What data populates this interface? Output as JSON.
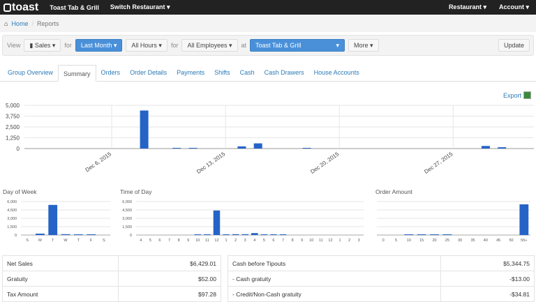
{
  "topbar": {
    "logo": "toast",
    "restaurant": "Toast Tab & Grill",
    "switch": "Switch Restaurant ▾",
    "menu_restaurant": "Restaurant ▾",
    "menu_account": "Account ▾"
  },
  "breadcrumb": {
    "home": "Home",
    "sep": "/",
    "current": "Reports"
  },
  "filters": {
    "view_label": "View",
    "view": "Sales ▾",
    "for1": "for",
    "period": "Last Month ▾",
    "hours": "All Hours ▾",
    "for2": "for",
    "employees": "All Employees ▾",
    "at": "at",
    "location": "Toast Tab & Grill",
    "location_caret": "▾",
    "more": "More ▾",
    "update": "Update"
  },
  "tabs": [
    "Group Overview",
    "Summary",
    "Orders",
    "Order Details",
    "Payments",
    "Shifts",
    "Cash",
    "Cash Drawers",
    "House Accounts"
  ],
  "active_tab": "Summary",
  "export": "Export",
  "colors": {
    "bar": "#2563c7",
    "accent": "#4a90d9",
    "link": "#2a7ab8"
  },
  "chart_data": [
    {
      "type": "bar",
      "title": "",
      "x_ticks": [
        "Dec 6, 2015",
        "Dec 13, 2015",
        "Dec 20, 2015",
        "Dec 27, 2015"
      ],
      "y_ticks": [
        "5,000",
        "3,750",
        "2,500",
        "1,250",
        "0"
      ],
      "ylim": [
        0,
        5000
      ],
      "grid": true,
      "x": [
        "Dec 8",
        "Dec 10",
        "Dec 11",
        "Dec 14",
        "Dec 15",
        "Dec 18",
        "Dec 29",
        "Dec 30"
      ],
      "day": [
        8,
        10,
        11,
        14,
        15,
        18,
        29,
        30
      ],
      "values": [
        4400,
        60,
        20,
        250,
        600,
        50,
        300,
        150
      ]
    },
    {
      "type": "bar",
      "title": "Day of Week",
      "categories": [
        "S",
        "M",
        "T",
        "W",
        "T",
        "F",
        "S"
      ],
      "values": [
        0,
        250,
        5400,
        150,
        80,
        80,
        0
      ],
      "y_ticks": [
        "6,000",
        "4,500",
        "3,000",
        "1,500",
        "0"
      ],
      "ylim": [
        0,
        6000
      ]
    },
    {
      "type": "bar",
      "title": "Time of Day",
      "categories": [
        "4",
        "5",
        "6",
        "7",
        "8",
        "9",
        "10",
        "11",
        "12",
        "1",
        "2",
        "3",
        "4",
        "5",
        "6",
        "7",
        "8",
        "9",
        "10",
        "11",
        "12",
        "1",
        "2",
        "3"
      ],
      "values": [
        0,
        0,
        0,
        0,
        0,
        0,
        30,
        100,
        4400,
        100,
        150,
        150,
        350,
        50,
        30,
        60,
        0,
        0,
        0,
        0,
        0,
        0,
        0,
        0
      ],
      "y_ticks": [
        "6,000",
        "4,500",
        "3,000",
        "1,500",
        "0"
      ],
      "ylim": [
        0,
        6000
      ]
    },
    {
      "type": "bar",
      "title": "Order Amount",
      "categories": [
        "0",
        "5",
        "10",
        "15",
        "20",
        "25",
        "30",
        "35",
        "40",
        "45",
        "50",
        "55+"
      ],
      "values": [
        0,
        0,
        60,
        80,
        50,
        40,
        0,
        0,
        0,
        0,
        0,
        5500
      ],
      "y_ticks": [],
      "ylim": [
        0,
        6000
      ]
    }
  ],
  "summary_left": [
    {
      "label": "Net Sales",
      "value": "$6,429.01"
    },
    {
      "label": "Gratuity",
      "value": "$52.00"
    },
    {
      "label": "Tax Amount",
      "value": "$97.28"
    }
  ],
  "summary_right": [
    {
      "label": "Cash before Tipouts",
      "value": "$5,344.75"
    },
    {
      "label": "- Cash gratuity",
      "value": "-$13.00"
    },
    {
      "label": "- Credit/Non-Cash gratuity",
      "value": "-$34.81"
    }
  ]
}
